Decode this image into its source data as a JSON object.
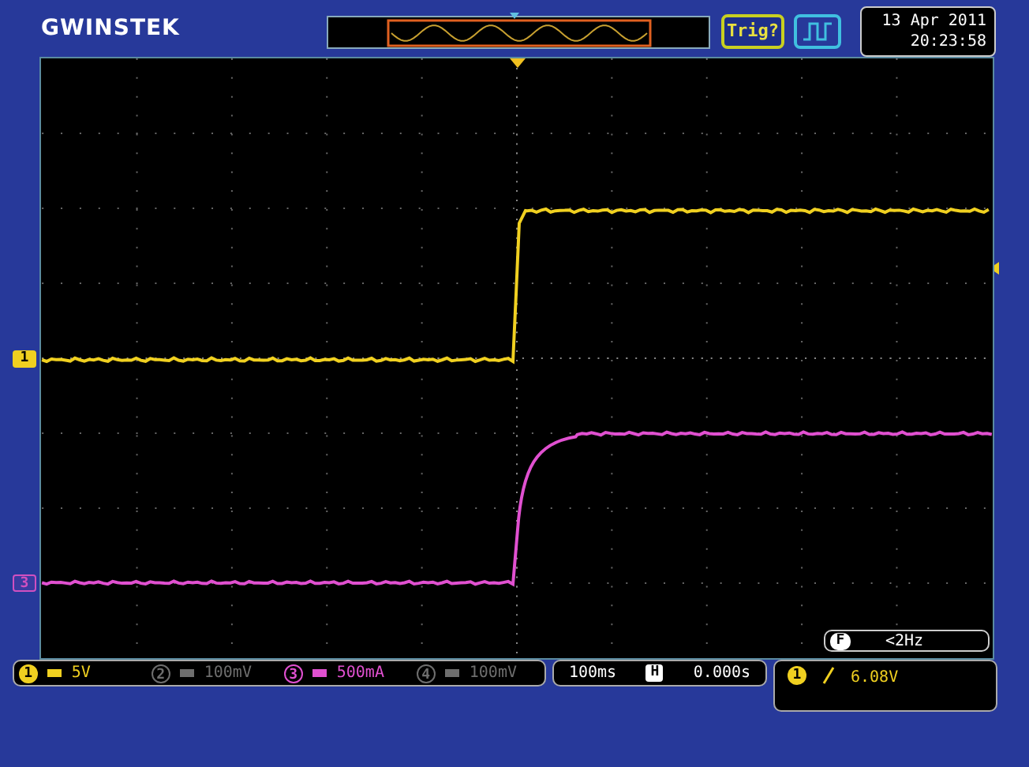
{
  "brand": "GWINSTEK",
  "date": "13 Apr 2011",
  "time": "20:23:58",
  "trigger_status": "Trig?",
  "channel_markers": [
    {
      "label": "1",
      "color": "#f0d020"
    },
    {
      "label": "3",
      "color": "#d050c0"
    }
  ],
  "filter": {
    "label": "F",
    "value": "<2Hz"
  },
  "channels": [
    {
      "label": "1",
      "scale": "5V",
      "color": "#f0d020"
    },
    {
      "label": "2",
      "scale": "100mV",
      "color": "#6e6e6e"
    },
    {
      "label": "3",
      "scale": "500mA",
      "color": "#e050d0"
    },
    {
      "label": "4",
      "scale": "100mV",
      "color": "#6e6e6e"
    }
  ],
  "timebase": {
    "scale": "100ms",
    "label": "H",
    "position": "0.000s"
  },
  "trigger": {
    "source": "1",
    "level": "6.08V"
  }
}
